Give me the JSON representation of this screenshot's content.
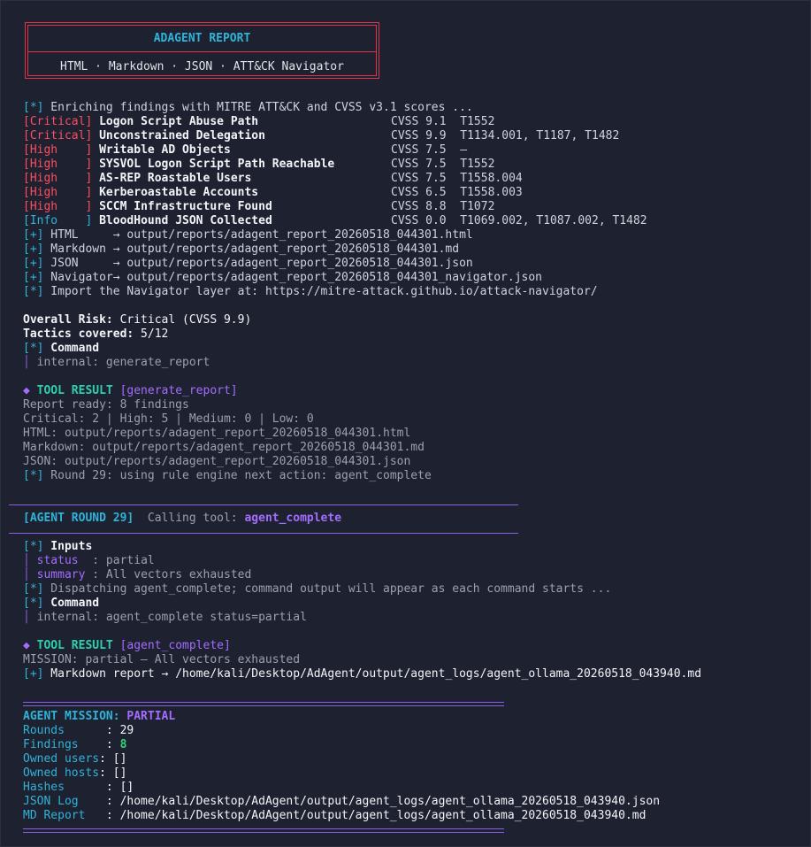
{
  "banner": {
    "title": "ADAGENT REPORT",
    "subtitle": "HTML · Markdown · JSON · ATT&CK Navigator"
  },
  "enrich_line": {
    "tag": "[*]",
    "text": " Enriching findings with MITRE ATT&CK and CVSS v3.1 scores ..."
  },
  "findings": [
    {
      "severity": "[Critical]",
      "title": "Logon Script Abuse Path",
      "cvss": "CVSS 9.1",
      "techniques": "T1552"
    },
    {
      "severity": "[Critical]",
      "title": "Unconstrained Delegation",
      "cvss": "CVSS 9.9",
      "techniques": "T1134.001, T1187, T1482"
    },
    {
      "severity": "[High    ]",
      "title": "Writable AD Objects",
      "cvss": "CVSS 7.5",
      "techniques": "—"
    },
    {
      "severity": "[High    ]",
      "title": "SYSVOL Logon Script Path Reachable",
      "cvss": "CVSS 7.5",
      "techniques": "T1552"
    },
    {
      "severity": "[High    ]",
      "title": "AS-REP Roastable Users",
      "cvss": "CVSS 7.5",
      "techniques": "T1558.004"
    },
    {
      "severity": "[High    ]",
      "title": "Kerberoastable Accounts",
      "cvss": "CVSS 6.5",
      "techniques": "T1558.003"
    },
    {
      "severity": "[High    ]",
      "title": "SCCM Infrastructure Found",
      "cvss": "CVSS 8.8",
      "techniques": "T1072"
    },
    {
      "severity": "[Info    ]",
      "title": "BloodHound JSON Collected",
      "cvss": "CVSS 0.0",
      "techniques": "T1069.002, T1087.002, T1482"
    }
  ],
  "outputs": [
    {
      "tag": "[+]",
      "label": " HTML     → ",
      "path": "output/reports/adagent_report_20260518_044301.html"
    },
    {
      "tag": "[+]",
      "label": " Markdown → ",
      "path": "output/reports/adagent_report_20260518_044301.md"
    },
    {
      "tag": "[+]",
      "label": " JSON     → ",
      "path": "output/reports/adagent_report_20260518_044301.json"
    },
    {
      "tag": "[+]",
      "label": " Navigator→ ",
      "path": "output/reports/adagent_report_20260518_044301_navigator.json"
    }
  ],
  "import_line": {
    "tag": "[*]",
    "text": " Import the Navigator layer at: https://mitre-attack.github.io/attack-navigator/"
  },
  "summary": {
    "risk_label": "Overall Risk:",
    "risk_value": " Critical (CVSS 9.9)",
    "tactics_label": "Tactics covered:",
    "tactics_value": " 5/12"
  },
  "command1": {
    "tag": "[*]",
    "label": " Command",
    "bar": "│",
    "text": " internal: generate_report"
  },
  "tool_result1": {
    "diamond": "◆",
    "label": " TOOL RESULT",
    "name": " [generate_report]",
    "lines": [
      "Report ready: 8 findings",
      "Critical: 2 | High: 5 | Medium: 0 | Low: 0",
      "HTML: output/reports/adagent_report_20260518_044301.html",
      "Markdown: output/reports/adagent_report_20260518_044301.md",
      "JSON: output/reports/adagent_report_20260518_044301.json"
    ],
    "round_tag": "[*]",
    "round_text": " Round 29: using rule engine next action: agent_complete"
  },
  "agent_round": {
    "label": "[AGENT ROUND 29]",
    "calling": "  Calling tool: ",
    "tool": "agent_complete"
  },
  "inputs": {
    "tag": "[*]",
    "label": " Inputs",
    "items": [
      {
        "bar": "│",
        "key": " status  ",
        "value": ": partial"
      },
      {
        "bar": "│",
        "key": " summary ",
        "value": ": All vectors exhausted"
      }
    ]
  },
  "dispatch_line": {
    "tag": "[*]",
    "text": " Dispatching agent_complete; command output will appear as each command starts ..."
  },
  "command2": {
    "tag": "[*]",
    "label": " Command",
    "bar": "│",
    "text": " internal: agent_complete status=partial"
  },
  "tool_result2": {
    "diamond": "◆",
    "label": " TOOL RESULT",
    "name": " [agent_complete]",
    "mission_line": "MISSION: partial — All vectors exhausted",
    "md_tag": "[+]",
    "md_text": " Markdown report → /home/kali/Desktop/AdAgent/output/agent_logs/agent_ollama_20260518_043940.md"
  },
  "mission": {
    "label": "AGENT MISSION: ",
    "status": "PARTIAL",
    "rows": [
      {
        "key": "Rounds      ",
        "sep": ": ",
        "value": "29"
      },
      {
        "key": "Findings    ",
        "sep": ": ",
        "value": "8"
      },
      {
        "key": "Owned users",
        "sep": ": ",
        "value": "[]"
      },
      {
        "key": "Owned hosts",
        "sep": ": ",
        "value": "[]"
      },
      {
        "key": "Hashes      ",
        "sep": ": ",
        "value": "[]"
      },
      {
        "key": "JSON Log    ",
        "sep": ": ",
        "value": "/home/kali/Desktop/AdAgent/output/agent_logs/agent_ollama_20260518_043940.json"
      },
      {
        "key": "MD Report   ",
        "sep": ": ",
        "value": "/home/kali/Desktop/AdAgent/output/agent_logs/agent_ollama_20260518_043940.md"
      }
    ]
  }
}
